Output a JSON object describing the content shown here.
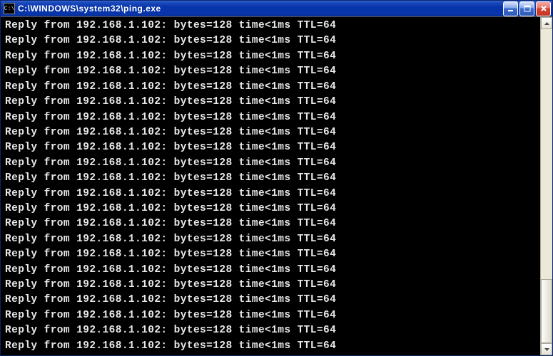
{
  "window": {
    "title": "C:\\WINDOWS\\system32\\ping.exe",
    "icon_text": "C:\\"
  },
  "console": {
    "reply_prefix": "Reply from",
    "ip": "192.168.1.102",
    "bytes_label": "bytes",
    "bytes_value": "128",
    "time_label": "time",
    "time_value": "<1ms",
    "ttl_label": "TTL",
    "ttl_value": "64",
    "line_count": 22
  }
}
